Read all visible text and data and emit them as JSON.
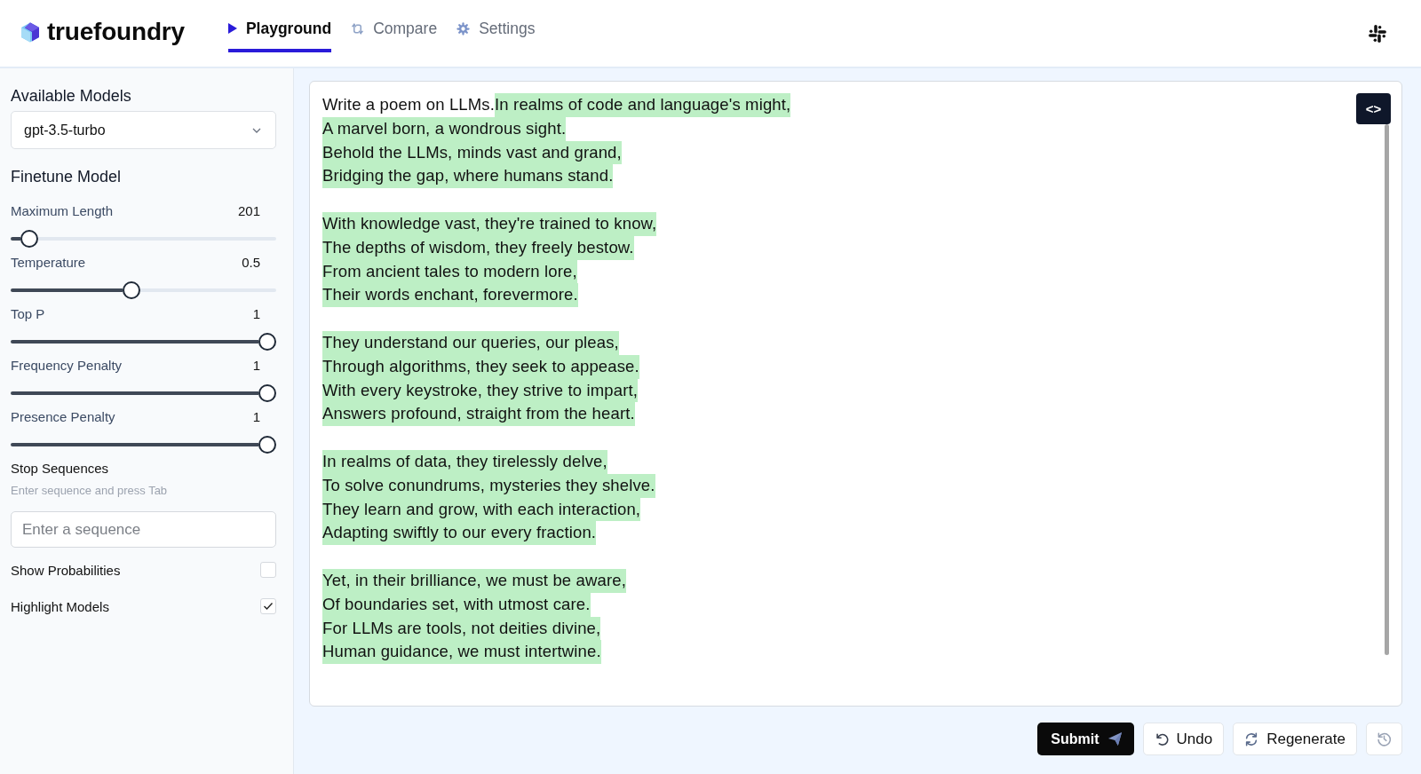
{
  "header": {
    "logo": "truefoundry",
    "tabs": [
      {
        "label": "Playground",
        "selected": true
      },
      {
        "label": "Compare",
        "selected": false
      },
      {
        "label": "Settings",
        "selected": false
      }
    ]
  },
  "sidebar": {
    "models": {
      "label": "Available Models",
      "value": "gpt-3.5-turbo"
    },
    "finetune": {
      "title": "Finetune Model",
      "params": [
        {
          "name": "Maximum Length",
          "reading": "201",
          "level": 0.04
        },
        {
          "name": "Temperature",
          "reading": "0.5",
          "level": 0.45
        },
        {
          "name": "Top P",
          "reading": "1",
          "level": 1
        },
        {
          "name": "Frequency Penalty",
          "reading": "1",
          "level": 1
        },
        {
          "name": "Presence Penalty",
          "reading": "1",
          "level": 1
        }
      ]
    },
    "stop_sequences": {
      "label": "Stop Sequences",
      "hint": "Enter sequence and press Tab",
      "placeholder": "Enter a sequence"
    },
    "toggles": [
      {
        "label": "Show Probabilities",
        "checked": false
      },
      {
        "label": "Highlight Models",
        "checked": true
      }
    ]
  },
  "editor": {
    "code_toggle": "<>",
    "prompt": "Write a poem on LLMs.",
    "completion": {
      "highlighted": true,
      "stanzas": [
        [
          "In realms of code and language's might,",
          "A marvel born, a wondrous sight.",
          "Behold the LLMs, minds vast and grand,",
          "Bridging the gap, where humans stand."
        ],
        [
          "With knowledge vast, they're trained to know,",
          "The depths of wisdom, they freely bestow.",
          "From ancient tales to modern lore,",
          "Their words enchant, forevermore."
        ],
        [
          "They understand our queries, our pleas,",
          "Through algorithms, they seek to appease.",
          "With every keystroke, they strive to impart,",
          "Answers profound, straight from the heart."
        ],
        [
          "In realms of data, they tirelessly delve,",
          "To solve conundrums, mysteries they shelve.",
          "They learn and grow, with each interaction,",
          "Adapting swiftly to our every fraction."
        ],
        [
          "Yet, in their brilliance, we must be aware,",
          "Of boundaries set, with utmost care.",
          "For LLMs are tools, not deities divine,",
          "Human guidance, we must intertwine."
        ]
      ]
    }
  },
  "actions": {
    "buttons": [
      {
        "label": "Submit",
        "kind": "primary"
      },
      {
        "label": "Undo",
        "kind": "secondary"
      },
      {
        "label": "Regenerate",
        "kind": "secondary"
      }
    ]
  }
}
